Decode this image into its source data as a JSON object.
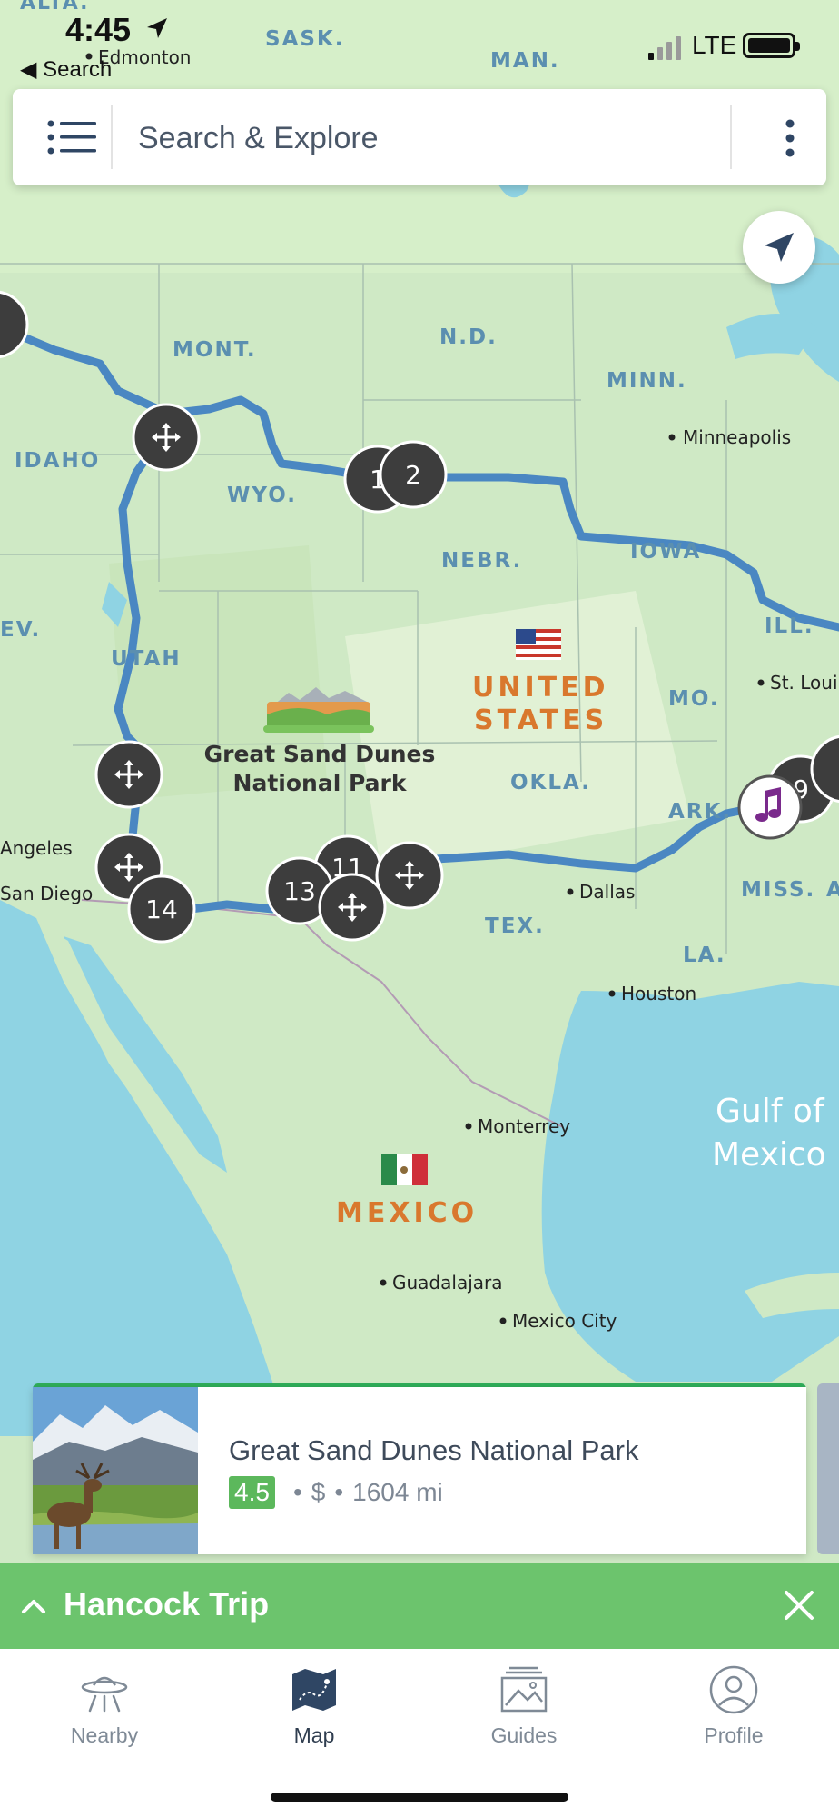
{
  "status_bar": {
    "time": "4:45",
    "back_label": "◀ Search",
    "network": "LTE"
  },
  "search": {
    "placeholder": "Search & Explore"
  },
  "map": {
    "labels": {
      "alta": "ALTA.",
      "sask": "SASK.",
      "man": "MAN.",
      "edmonton": "Edmonton",
      "mont": "MONT.",
      "nd": "N.D.",
      "minn": "MINN.",
      "minneapolis": "Minneapolis",
      "idaho": "IDAHO",
      "wyo": "WYO.",
      "nebr": "NEBR.",
      "iowa": "IOWA",
      "ill": "ILL.",
      "nev": "EV.",
      "utah": "UTAH",
      "united": "UNITED",
      "states": "STATES",
      "mo": "MO.",
      "st_louis": "St. Loui",
      "okla": "OKLA.",
      "ark": "ARK.",
      "angeles": "Angeles",
      "san_diego": "San Diego",
      "dallas": "Dallas",
      "miss": "MISS.",
      "miss_a": "A",
      "tex": "TEX.",
      "la": "LA.",
      "houston": "Houston",
      "gulf1": "Gulf of",
      "gulf2": "Mexico",
      "monterrey": "Monterrey",
      "mexico": "MEXICO",
      "guadalajara": "Guadalajara",
      "mexico_city": "Mexico City",
      "poi_line1": "Great Sand Dunes",
      "poi_line2": "National Park"
    },
    "markers": {
      "m1": "1",
      "m2": "2",
      "m11": "11",
      "m13": "13",
      "m14": "14",
      "m9": "9"
    },
    "colors": {
      "route": "#4a87c2",
      "land": "#cfe9c5",
      "water": "#8fd3e3",
      "marker": "#3d3d3d",
      "country_label": "#d9782d",
      "state_label": "#5b8fb0"
    }
  },
  "place_card": {
    "name": "Great Sand Dunes National Park",
    "rating": "4.5",
    "price": "$",
    "distance": "1604 mi"
  },
  "trip_bar": {
    "title": "Hancock Trip"
  },
  "tabs": {
    "nearby": "Nearby",
    "map": "Map",
    "guides": "Guides",
    "profile": "Profile"
  }
}
